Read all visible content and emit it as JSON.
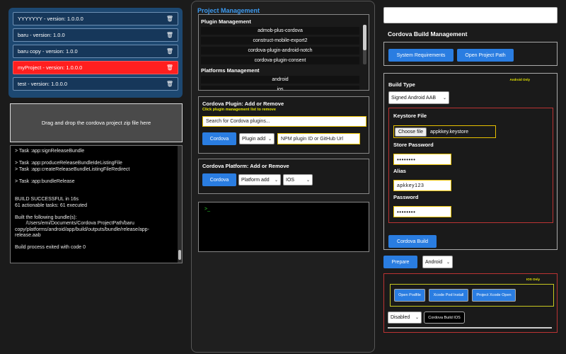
{
  "projects": [
    {
      "label": "YYYYYYY - version: 1.0.0.0",
      "active": false
    },
    {
      "label": "baru - version: 1.0.0",
      "active": false
    },
    {
      "label": "baru copy - version: 1.0.0",
      "active": false
    },
    {
      "label": "myProject - version: 1.0.0.0",
      "active": true
    },
    {
      "label": "test - version: 1.0.0.0",
      "active": false
    }
  ],
  "dropzone": {
    "text": "Drag and drop the cordova project zip file here"
  },
  "log": {
    "lines": [
      "> Task :app:signReleaseBundle",
      "",
      "> Task :app:produceReleaseBundleIdeListingFile",
      "> Task :app:createReleaseBundleListingFileRedirect",
      "",
      "> Task :app:bundleRelease",
      "",
      "",
      "BUILD SUCCESSFUL in 16s",
      "61 actionable tasks: 61 executed",
      "",
      "Built the following bundle(s):",
      "        /Users/emi/Documents/Cordova ProjectPath/baru",
      "copy/platforms/android/app/build/outputs/bundle/release/app-",
      "release.aab",
      "",
      "Build process exited with code 0"
    ]
  },
  "project_management": {
    "title": "Project Management",
    "plugin_heading": "Plugin Management",
    "plugins": [
      "admob-plus-cordova",
      "construct-mobile-export2",
      "cordova-plugin-android-notch",
      "cordova-plugin-consent"
    ],
    "platforms_heading": "Platforms Management",
    "platforms": [
      "android",
      "ios"
    ]
  },
  "plugin_panel": {
    "heading": "Cordova Plugin: Add or Remove",
    "hint": "Click plugin management list to remove",
    "search_placeholder": "Search for Cordova plugins...",
    "button": "Cordova",
    "action": "Plugin add",
    "id_placeholder": "NPM plugin ID or GitHub Url"
  },
  "platform_panel": {
    "heading": "Cordova Platform: Add or Remove",
    "button": "Cordova",
    "action": "Platform add",
    "platform": "IOS"
  },
  "terminal": {
    "prompt": ">_"
  },
  "build": {
    "heading": "Cordova Build Management",
    "sys_req": "System Requirements",
    "open_path": "Open Project Path",
    "android_only": "Android Only",
    "build_type_label": "Build Type",
    "build_type": "Signed Android AAB",
    "keystore_label": "Keystore File",
    "choose_file": "Choose file",
    "keystore_file": "appkkey.keystore",
    "store_password_label": "Store Password",
    "store_password": "••••••••",
    "alias_label": "Alias",
    "alias": "apkkey123",
    "password_label": "Password",
    "password": "••••••••",
    "build_button": "Cordova Build",
    "prepare": "Prepare",
    "prepare_platform": "Android",
    "ios_only": "IOS Only",
    "open_podfile": "Open Podfile",
    "xcode_pod_install": "Xcode Pod Install",
    "project_xcode_open": "Project Xcode Open",
    "ios_mode": "Disabled",
    "build_ios": "Cordova Build IOS"
  }
}
